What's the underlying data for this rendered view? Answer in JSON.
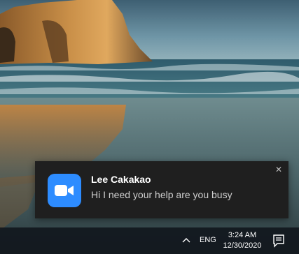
{
  "notification": {
    "sender": "Lee Cakakao",
    "message": "Hi I need your help are you busy",
    "close_glyph": "✕",
    "app_icon": "zoom-video-camera-icon",
    "icon_color": "#2d8cff",
    "background_color": "#1f1f1f"
  },
  "taskbar": {
    "language": "ENG",
    "time": "3:24 AM",
    "date": "12/30/2020",
    "overflow_icon": "chevron-up-icon",
    "action_center_icon": "action-center-icon"
  }
}
